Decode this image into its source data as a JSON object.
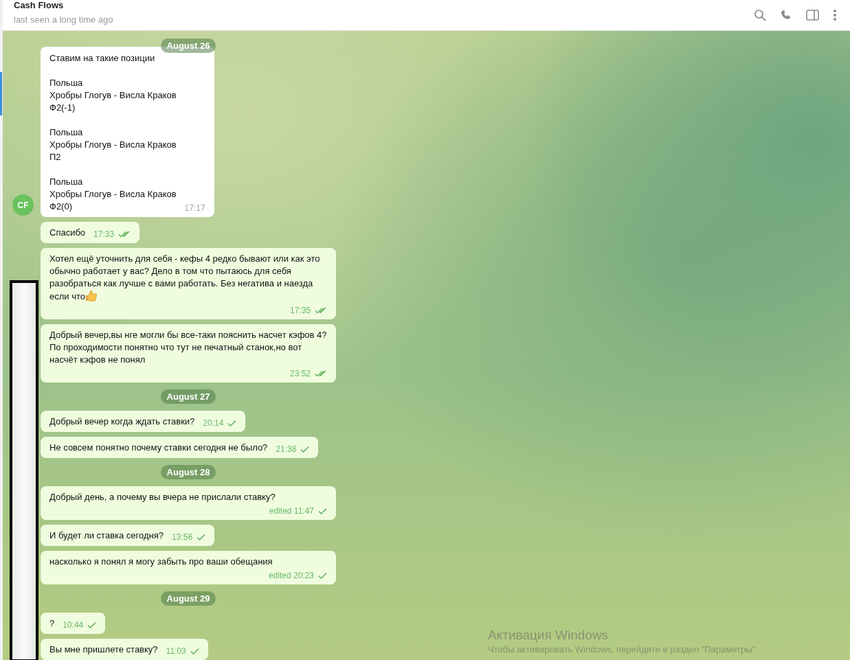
{
  "header": {
    "title": "Cash Flows",
    "status": "last seen a long time ago"
  },
  "feed": [
    {
      "kind": "date",
      "label": "August 26"
    },
    {
      "kind": "incoming",
      "avatar": "CF",
      "text": "Ставим на такие позиции\n\nПольша\nХробры Глогув - Висла Краков\nФ2(-1)\n\nПольша\nХробры Глогув - Висла Краков\nП2\n\nПольша\nХробры Глогув - Висла Краков\nФ2(0)",
      "time": "17:17"
    },
    {
      "kind": "outgoing",
      "text": "Спасибо",
      "time": "17:33",
      "read": true
    },
    {
      "kind": "outgoing",
      "text": "Хотел ещё уточнить для себя - кефы 4 редко бывают или как это обычно работает у вас? Дело в том что пытаюсь для себя разобраться как лучше с вами работать. Без негатива и наезда если что",
      "emoji": {
        "kind": "thumbs-up"
      },
      "time": "17:35",
      "read": true
    },
    {
      "kind": "outgoing",
      "text": "Добрый вечер,вы нге могли бы все-таки пояснить насчет кэфов 4?По проходимости понятно что тут не печатный станок,но вот насчёт кэфов не понял",
      "time": "23:52",
      "read": true
    },
    {
      "kind": "date",
      "label": "August 27"
    },
    {
      "kind": "outgoing",
      "text": "Добрый вечер когда ждать ставки?",
      "time": "20:14",
      "read": false
    },
    {
      "kind": "outgoing",
      "text": "Не совсем понятно почему ставки сегодня не было?",
      "time": "21:38",
      "read": false
    },
    {
      "kind": "date",
      "label": "August 28"
    },
    {
      "kind": "outgoing",
      "text": "Добрый день, а почему вы вчера не прислали ставку?",
      "time": "edited 11:47",
      "read": false
    },
    {
      "kind": "outgoing",
      "text": "И будет ли ставка сегодня?",
      "time": "13:56",
      "read": false
    },
    {
      "kind": "outgoing",
      "text": "насколько я понял я могу забыть про ваши обещания",
      "time": "edited 20:23",
      "read": false
    },
    {
      "kind": "date",
      "label": "August 29"
    },
    {
      "kind": "outgoing",
      "text": "?",
      "time": "10:44",
      "read": false
    },
    {
      "kind": "outgoing",
      "text": "Вы мне пришлете ставку?",
      "time": "11:03",
      "read": false
    }
  ],
  "system_overlay": {
    "title": "Активация Windows",
    "hint": "Чтобы активировать Windows, перейдите в раздел \"Параметры\""
  }
}
